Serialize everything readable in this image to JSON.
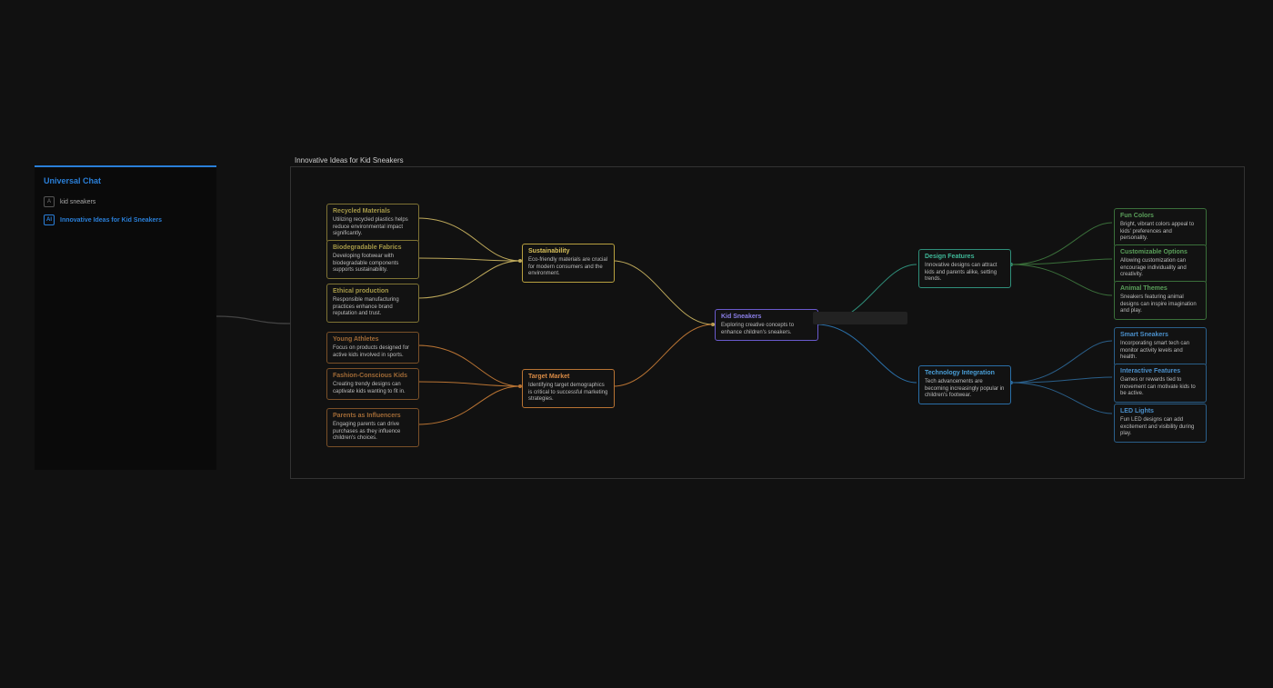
{
  "sidebar": {
    "title": "Universal Chat",
    "items": [
      {
        "marker": "A",
        "label": "kid sneakers"
      },
      {
        "marker": "AI",
        "label": "Innovative Ideas for Kid Sneakers"
      }
    ]
  },
  "canvas": {
    "title": "Innovative Ideas for Kid Sneakers"
  },
  "nodes": {
    "root": {
      "title": "Kid Sneakers",
      "desc": "Exploring creative concepts to enhance children's sneakers."
    },
    "sustain": {
      "title": "Sustainability",
      "desc": "Eco-friendly materials are crucial for modern consumers and the environment."
    },
    "market": {
      "title": "Target Market",
      "desc": "Identifying target demographics is critical to successful marketing strategies."
    },
    "design": {
      "title": "Design Features",
      "desc": "Innovative designs can attract kids and parents alike, setting trends."
    },
    "tech": {
      "title": "Technology Integration",
      "desc": "Tech advancements are becoming increasingly popular in children's footwear."
    },
    "recycled": {
      "title": "Recycled Materials",
      "desc": "Utilizing recycled plastics helps reduce environmental impact significantly."
    },
    "biodeg": {
      "title": "Biodegradable Fabrics",
      "desc": "Developing footwear with biodegradable components supports sustainability."
    },
    "ethical": {
      "title": "Ethical production",
      "desc": "Responsible manufacturing practices enhance brand reputation and trust."
    },
    "young": {
      "title": "Young Athletes",
      "desc": "Focus on products designed for active kids involved in sports."
    },
    "fashion": {
      "title": "Fashion-Conscious Kids",
      "desc": "Creating trendy designs can captivate kids wanting to fit in."
    },
    "parents": {
      "title": "Parents as Influencers",
      "desc": "Engaging parents can drive purchases as they influence children's choices."
    },
    "funcolors": {
      "title": "Fun Colors",
      "desc": "Bright, vibrant colors appeal to kids' preferences and personality."
    },
    "custom": {
      "title": "Customizable Options",
      "desc": "Allowing customization can encourage individuality and creativity."
    },
    "animal": {
      "title": "Animal Themes",
      "desc": "Sneakers featuring animal designs can inspire imagination and play."
    },
    "smart": {
      "title": "Smart Sneakers",
      "desc": "Incorporating smart tech can monitor activity levels and health."
    },
    "interactive": {
      "title": "Interactive Features",
      "desc": "Games or rewards tied to movement can motivate kids to be active."
    },
    "led": {
      "title": "LED Lights",
      "desc": "Fun LED designs can add excitement and visibility during play."
    }
  }
}
